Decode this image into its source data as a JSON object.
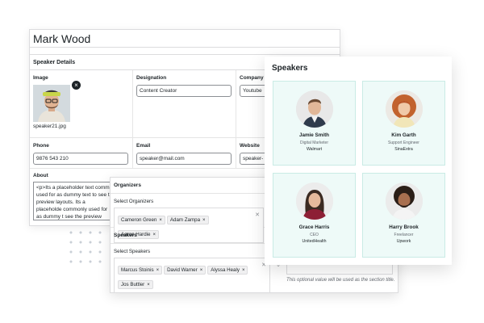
{
  "speaker_edit": {
    "title": "Mark Wood",
    "section_title": "Speaker Details",
    "image_label": "Image",
    "image_filename": "speaker21.jpg",
    "designation_label": "Designation",
    "designation_value": "Content Creator",
    "company_label": "Company",
    "company_value": "Youtube",
    "phone_label": "Phone",
    "phone_value": "9876 543 210",
    "email_label": "Email",
    "email_value": "speaker@mail.com",
    "website_label": "Website",
    "website_value": "speaker-",
    "about_label": "About",
    "about_value": "<p>Its a placeholder text comm used for as dummy text to see t preview layouts. Its a placeholde commonly used for as dummy t see the preview layouts. Its a plac"
  },
  "selectors": {
    "organizers_title": "Organizers",
    "organizers_label": "Select Organizers",
    "organizers": [
      "Cameron Green",
      "Adam Zampa",
      "Aaron Hardie"
    ],
    "speakers_title": "Speakers",
    "speakers_label": "Select Speakers",
    "speakers": [
      "Marcus Stoinis",
      "David Warner",
      "Alyssa Healy",
      "Jos Buttler"
    ],
    "hint": "This optional value will be used as the section title."
  },
  "preview": {
    "heading": "Speakers",
    "cards": [
      {
        "name": "Jamie Smith",
        "role": "Digital Marketer",
        "org": "Walmart"
      },
      {
        "name": "Kim Garth",
        "role": "Support Engineer",
        "org": "SinaExtra"
      },
      {
        "name": "Grace Harris",
        "role": "CEO",
        "org": "UnitedHealth"
      },
      {
        "name": "Harry Brook",
        "role": "Freelancer",
        "org": "Upwork"
      }
    ]
  },
  "icons": {
    "remove": "close-circle-icon",
    "clear": "close-icon",
    "dropdown": "chevron-down-icon"
  },
  "colors": {
    "card_background": "#eefaf8",
    "card_border": "#c9ebe5"
  }
}
